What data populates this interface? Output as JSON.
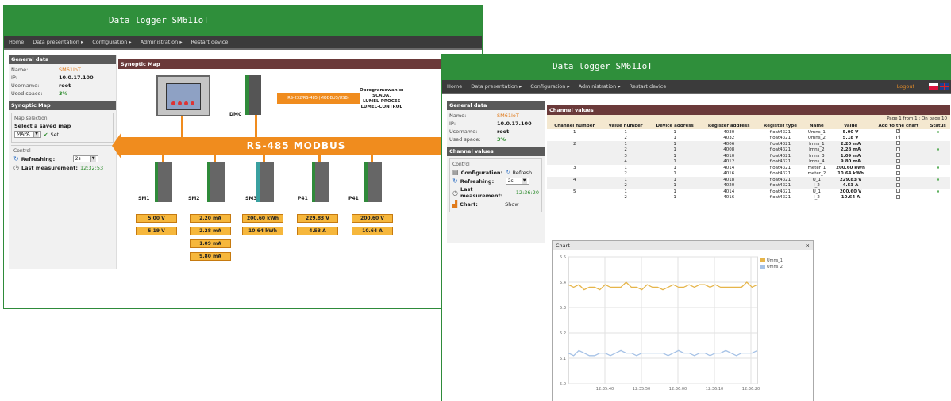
{
  "app_title": "Data logger SM61IoT",
  "menu": [
    "Home",
    "Data presentation ▸",
    "Configuration ▸",
    "Administration ▸",
    "Restart device"
  ],
  "logout_label": "Logout",
  "general": {
    "title": "General data",
    "name_label": "Name:",
    "name_value": "SM61IoT",
    "ip_label": "IP:",
    "ip_value": "10.0.17.100",
    "user_label": "Username:",
    "user_value": "root",
    "space_label": "Used space:",
    "space_value": "3%"
  },
  "left_window": {
    "panel2_title": "Synoptic Map",
    "map_selection_legend": "Map selection",
    "select_map_label": "Select a saved map",
    "map_value": "MAPA",
    "set_label": "Set",
    "control_legend": "Control",
    "refreshing_label": "Refreshing:",
    "refresh_value": "2s",
    "last_meas_label": "Last measurement:",
    "last_meas_value": "12:32:53",
    "content_title": "Synoptic Map",
    "dmc_label": "DMC",
    "small_arrow_text": "RS-232/RS-485 (MODBUS/USB)",
    "software_line1": "Oprogramowanie:",
    "software_line2": "SCADA,",
    "software_line3": "LUMEL-PROCES",
    "software_line4": "LUMEL-CONTROL",
    "bus_label": "RS-485 MODBUS",
    "devices": [
      {
        "label": "SM1",
        "values": [
          "5.00 V",
          "5.19 V"
        ]
      },
      {
        "label": "SM2",
        "values": [
          "2.20 mA",
          "2.28 mA",
          "1.09 mA",
          "9.80 mA"
        ]
      },
      {
        "label": "SM3",
        "values": [
          "200.60 kWh",
          "10.64 kWh"
        ]
      },
      {
        "label": "P41",
        "values": [
          "229.83 V",
          "4.53 A"
        ]
      },
      {
        "label": "P41",
        "values": [
          "200.60 V",
          "10.64 A"
        ]
      }
    ]
  },
  "right_window": {
    "panel2_title": "Channel values",
    "control_legend": "Control",
    "config_label": "Configuration:",
    "refresh_link": "Refresh",
    "refreshing_label": "Refreshing:",
    "refresh_value": "2s",
    "last_meas_label": "Last measurement:",
    "last_meas_value": "12:36:20",
    "chart_label": "Chart:",
    "chart_value": "Show",
    "content_title": "Channel values",
    "pager_text": "Page 1 from 1 : On page 10",
    "columns": [
      "Channel number",
      "Value number",
      "Device address",
      "Register address",
      "Register type",
      "Name",
      "Value",
      "Add to the chart",
      "Status"
    ],
    "rows": [
      {
        "ch": "1",
        "vn": "1",
        "addr": "1",
        "reg": "4030",
        "type": "float4321",
        "name": "Umns_1",
        "value": "5.00 V",
        "checked": true,
        "alt": false,
        "status": true
      },
      {
        "ch": "",
        "vn": "2",
        "addr": "1",
        "reg": "4032",
        "type": "float4321",
        "name": "Umns_2",
        "value": "5.18 V",
        "checked": true,
        "alt": false,
        "status": false
      },
      {
        "ch": "2",
        "vn": "1",
        "addr": "1",
        "reg": "4006",
        "type": "float4321",
        "name": "Imns_1",
        "value": "2.20 mA",
        "checked": false,
        "alt": true,
        "status": false
      },
      {
        "ch": "",
        "vn": "2",
        "addr": "1",
        "reg": "4008",
        "type": "float4321",
        "name": "Imns_2",
        "value": "2.28 mA",
        "checked": false,
        "alt": true,
        "status": true
      },
      {
        "ch": "",
        "vn": "3",
        "addr": "1",
        "reg": "4010",
        "type": "float4321",
        "name": "Imns_3",
        "value": "1.09 mA",
        "checked": false,
        "alt": true,
        "status": false
      },
      {
        "ch": "",
        "vn": "4",
        "addr": "1",
        "reg": "4012",
        "type": "float4321",
        "name": "Imns_4",
        "value": "9.80 mA",
        "checked": false,
        "alt": true,
        "status": false
      },
      {
        "ch": "3",
        "vn": "1",
        "addr": "1",
        "reg": "4014",
        "type": "float4321",
        "name": "meter_1",
        "value": "200.60 kWh",
        "checked": false,
        "alt": false,
        "status": true
      },
      {
        "ch": "",
        "vn": "2",
        "addr": "1",
        "reg": "4016",
        "type": "float4321",
        "name": "meter_2",
        "value": "10.64 kWh",
        "checked": false,
        "alt": false,
        "status": false
      },
      {
        "ch": "4",
        "vn": "1",
        "addr": "1",
        "reg": "4018",
        "type": "float4321",
        "name": "U_1",
        "value": "229.83 V",
        "checked": false,
        "alt": true,
        "status": true
      },
      {
        "ch": "",
        "vn": "2",
        "addr": "1",
        "reg": "4020",
        "type": "float4321",
        "name": "I_2",
        "value": "4.53 A",
        "checked": false,
        "alt": true,
        "status": false
      },
      {
        "ch": "5",
        "vn": "1",
        "addr": "1",
        "reg": "4014",
        "type": "float4321",
        "name": "U_1",
        "value": "200.60 V",
        "checked": false,
        "alt": false,
        "status": true
      },
      {
        "ch": "",
        "vn": "2",
        "addr": "1",
        "reg": "4016",
        "type": "float4321",
        "name": "I_2",
        "value": "10.64 A",
        "checked": false,
        "alt": false,
        "status": false
      }
    ]
  },
  "chart_data": {
    "type": "line",
    "title": "Chart",
    "x": [
      "12:35:40",
      "12:35:50",
      "12:36:00",
      "12:36:10",
      "12:36:20"
    ],
    "ylim": [
      5.0,
      5.5
    ],
    "yticks": [
      "5.5",
      "5.4",
      "5.3",
      "5.2",
      "5.1",
      "5.0"
    ],
    "grid": true,
    "legend": "top-right",
    "series": [
      {
        "name": "Umns_1",
        "color": "#e6b54a",
        "values": [
          5.39,
          5.38,
          5.39,
          5.37,
          5.38,
          5.38,
          5.37,
          5.39,
          5.38,
          5.38,
          5.38,
          5.4,
          5.38,
          5.38,
          5.37,
          5.39,
          5.38,
          5.38,
          5.37,
          5.38,
          5.39,
          5.38,
          5.38,
          5.39,
          5.38,
          5.39,
          5.39,
          5.38,
          5.39,
          5.38,
          5.38,
          5.38,
          5.38,
          5.38,
          5.4,
          5.38,
          5.39
        ]
      },
      {
        "name": "Umns_2",
        "color": "#a6c2e6",
        "values": [
          5.12,
          5.11,
          5.13,
          5.12,
          5.11,
          5.11,
          5.12,
          5.12,
          5.11,
          5.12,
          5.13,
          5.12,
          5.12,
          5.11,
          5.12,
          5.12,
          5.12,
          5.12,
          5.12,
          5.11,
          5.12,
          5.13,
          5.12,
          5.12,
          5.11,
          5.12,
          5.12,
          5.11,
          5.12,
          5.12,
          5.13,
          5.12,
          5.11,
          5.12,
          5.12,
          5.12,
          5.13
        ]
      }
    ]
  }
}
